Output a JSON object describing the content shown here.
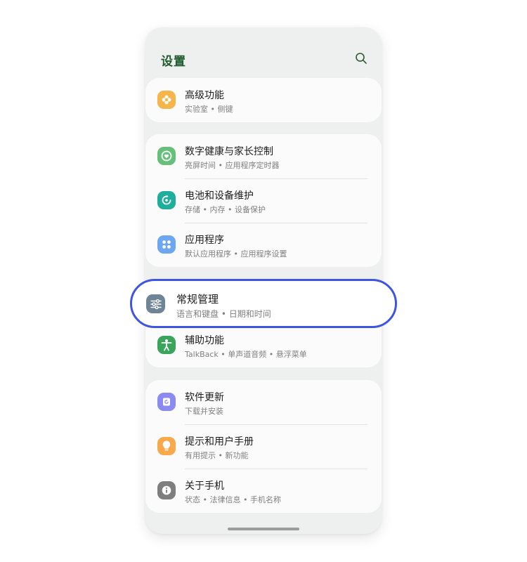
{
  "header": {
    "title": "设置",
    "search_icon": "search-icon"
  },
  "cards": [
    {
      "items": [
        {
          "title": "高级功能",
          "subtitle": "实验室 • 侧键",
          "icon": "gear-flower-icon",
          "color": "#f5b54a"
        }
      ]
    },
    {
      "items": [
        {
          "title": "数字健康与家长控制",
          "subtitle": "亮屏时间 • 应用程序定时器",
          "icon": "digital-wellbeing-icon",
          "color": "#66c07a"
        },
        {
          "title": "电池和设备维护",
          "subtitle": "存储 • 内存 • 设备保护",
          "icon": "device-care-icon",
          "color": "#1fae9c"
        },
        {
          "title": "应用程序",
          "subtitle": "默认应用程序 • 应用程序设置",
          "icon": "apps-grid-icon",
          "color": "#6da7ef"
        }
      ]
    },
    {
      "items": [
        {
          "title": "辅助功能",
          "subtitle": "TalkBack • 单声道音频 • 悬浮菜单",
          "icon": "accessibility-icon",
          "color": "#3aa55a"
        }
      ]
    },
    {
      "items": [
        {
          "title": "软件更新",
          "subtitle": "下载并安装",
          "icon": "software-update-icon",
          "color": "#8b8af0"
        },
        {
          "title": "提示和用户手册",
          "subtitle": "有用提示 • 新功能",
          "icon": "lightbulb-icon",
          "color": "#f7a94b"
        },
        {
          "title": "关于手机",
          "subtitle": "状态 • 法律信息 • 手机名称",
          "icon": "info-icon",
          "color": "#7e7e7e"
        }
      ]
    }
  ],
  "highlighted": {
    "title": "常规管理",
    "subtitle": "语言和键盘 • 日期和时间",
    "icon": "sliders-icon",
    "color": "#6f8597",
    "ring_color": "#3d55e0"
  }
}
